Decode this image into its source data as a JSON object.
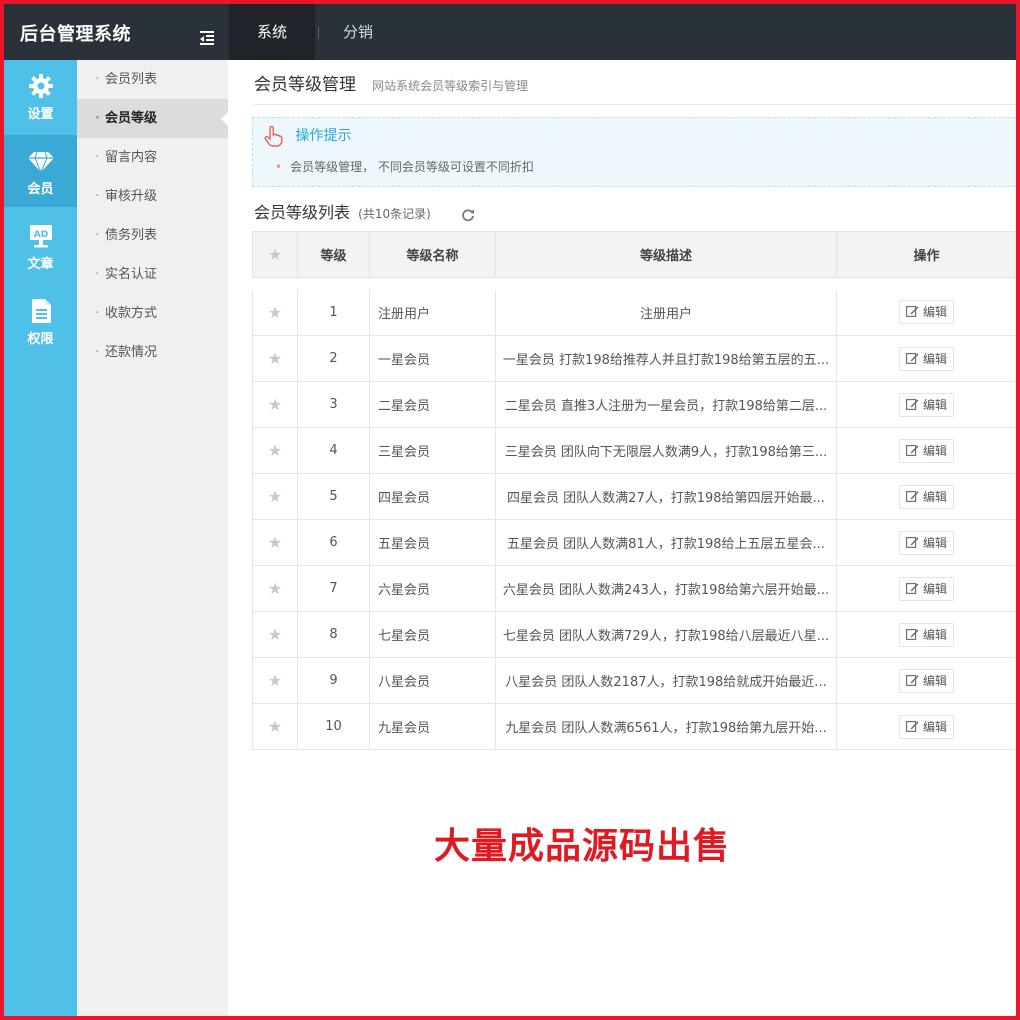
{
  "app": {
    "title": "后台管理系统"
  },
  "topnav": {
    "items": [
      "系统",
      "分销"
    ]
  },
  "iconbar": {
    "items": [
      {
        "label": "设置",
        "icon": "gear-icon"
      },
      {
        "label": "会员",
        "icon": "diamond-icon"
      },
      {
        "label": "文章",
        "icon": "ad-icon"
      },
      {
        "label": "权限",
        "icon": "document-icon"
      }
    ]
  },
  "subbar": {
    "items": [
      "会员列表",
      "会员等级",
      "留言内容",
      "审核升级",
      "债务列表",
      "实名认证",
      "收款方式",
      "还款情况"
    ],
    "active": "会员等级"
  },
  "page": {
    "title": "会员等级管理",
    "subtitle": "网站系统会员等级索引与管理"
  },
  "tips": {
    "title": "操作提示",
    "text": "会员等级管理， 不同会员等级可设置不同折扣"
  },
  "list": {
    "title": "会员等级列表",
    "count": "(共10条记录)",
    "columns": [
      "等级",
      "等级名称",
      "等级描述",
      "操作"
    ],
    "edit_label": "编辑",
    "rows": [
      {
        "level": "1",
        "name": "注册用户",
        "desc": "注册用户"
      },
      {
        "level": "2",
        "name": "一星会员",
        "desc": "一星会员 打款198给推荐人并且打款198给第五层的五..."
      },
      {
        "level": "3",
        "name": "二星会员",
        "desc": "二星会员 直推3人注册为一星会员，打款198给第二层..."
      },
      {
        "level": "4",
        "name": "三星会员",
        "desc": "三星会员 团队向下无限层人数满9人，打款198给第三..."
      },
      {
        "level": "5",
        "name": "四星会员",
        "desc": "四星会员 团队人数满27人，打款198给第四层开始最..."
      },
      {
        "level": "6",
        "name": "五星会员",
        "desc": "五星会员 团队人数满81人，打款198给上五层五星会..."
      },
      {
        "level": "7",
        "name": "六星会员",
        "desc": "六星会员 团队人数满243人，打款198给第六层开始最..."
      },
      {
        "level": "8",
        "name": "七星会员",
        "desc": "七星会员 团队人数满729人，打款198给八层最近八星..."
      },
      {
        "level": "9",
        "name": "八星会员",
        "desc": "八星会员 团队人数2187人，打款198给就成开始最近..."
      },
      {
        "level": "10",
        "name": "九星会员",
        "desc": "九星会员 团队人数满6561人，打款198给第九层开始..."
      }
    ]
  },
  "promo": {
    "text": "大量成品源码出售"
  },
  "colors": {
    "frame": "#e8152b",
    "topbar": "#2a3138",
    "iconbar": "#4fc1e9",
    "tips_title": "#26a7d9",
    "promo": "#e01a22"
  }
}
